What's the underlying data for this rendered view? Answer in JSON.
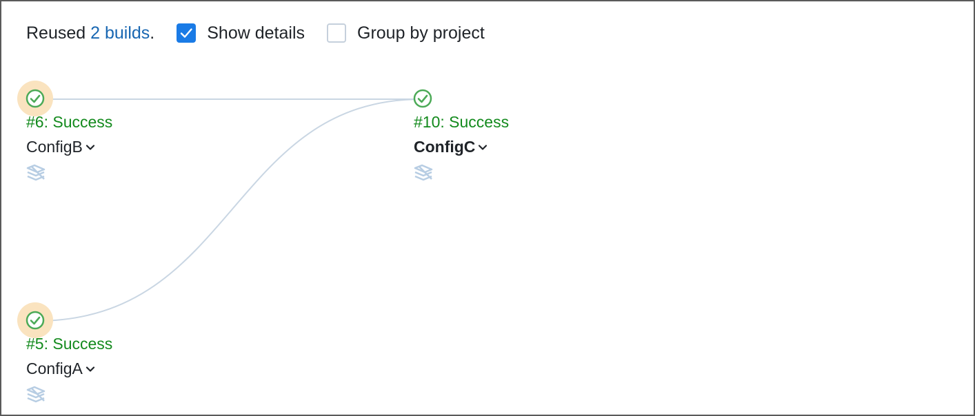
{
  "toolbar": {
    "reused_prefix": "Reused",
    "reused_link": "2 builds",
    "reused_suffix": ".",
    "show_details": {
      "label": "Show details",
      "checked": true
    },
    "group_by_project": {
      "label": "Group by project",
      "checked": false
    }
  },
  "colors": {
    "link": "#1967b2",
    "success": "#138a1d",
    "checkbox_on": "#1a7be6",
    "edge": "#c9d6e3",
    "halo": "#fae3bf"
  },
  "nodes": [
    {
      "id": "b6",
      "status_icon": "success-check-icon",
      "status": "#6: Success",
      "config": "ConfigB",
      "highlighted": true,
      "bold": false,
      "agent_icon": "agent-stack-icon"
    },
    {
      "id": "b10",
      "status_icon": "success-check-icon",
      "status": "#10: Success",
      "config": "ConfigC",
      "highlighted": false,
      "bold": true,
      "agent_icon": "agent-stack-icon"
    },
    {
      "id": "b5",
      "status_icon": "success-check-icon",
      "status": "#5: Success",
      "config": "ConfigA",
      "highlighted": true,
      "bold": false,
      "agent_icon": "agent-stack-icon"
    }
  ],
  "edges": [
    {
      "from": "b6",
      "to": "b10"
    },
    {
      "from": "b5",
      "to": "b10"
    }
  ]
}
